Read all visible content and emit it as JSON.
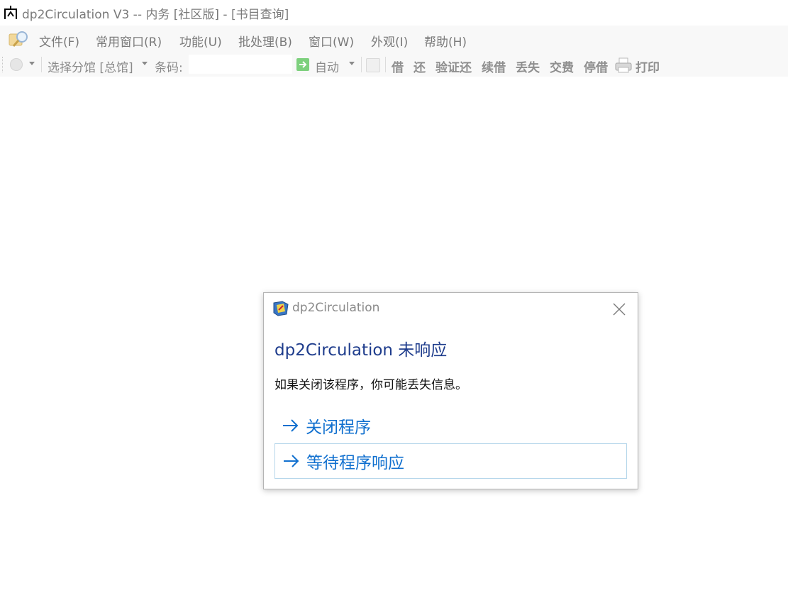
{
  "window": {
    "title": "dp2Circulation V3 -- 内务 [社区版] - [书目查询]",
    "app_icon": "spider-logo-icon"
  },
  "menubar": {
    "icon": "magnifier-folder-icon",
    "items": [
      {
        "label": "文件(F)"
      },
      {
        "label": "常用窗口(R)"
      },
      {
        "label": "功能(U)"
      },
      {
        "label": "批处理(B)"
      },
      {
        "label": "窗口(W)"
      },
      {
        "label": "外观(I)"
      },
      {
        "label": "帮助(H)"
      }
    ]
  },
  "toolbar": {
    "library_selector": "选择分馆 [总馆]",
    "barcode_label": "条码:",
    "barcode_value": "",
    "auto_label": "自动",
    "buttons": [
      {
        "label": "借"
      },
      {
        "label": "还"
      },
      {
        "label": "验证还"
      },
      {
        "label": "续借"
      },
      {
        "label": "丢失"
      },
      {
        "label": "交费"
      },
      {
        "label": "停借"
      }
    ],
    "print_label": "打印"
  },
  "dialog": {
    "title": "dp2Circulation",
    "heading": "dp2Circulation 未响应",
    "message": "如果关闭该程序，你可能丢失信息。",
    "options": [
      {
        "label": "关闭程序"
      },
      {
        "label": "等待程序响应"
      }
    ]
  },
  "colors": {
    "dialog_heading": "#1e3c8c",
    "dialog_option": "#1170cf",
    "focus_border": "#b5d6ea",
    "menu_text": "#7a7a7a"
  }
}
